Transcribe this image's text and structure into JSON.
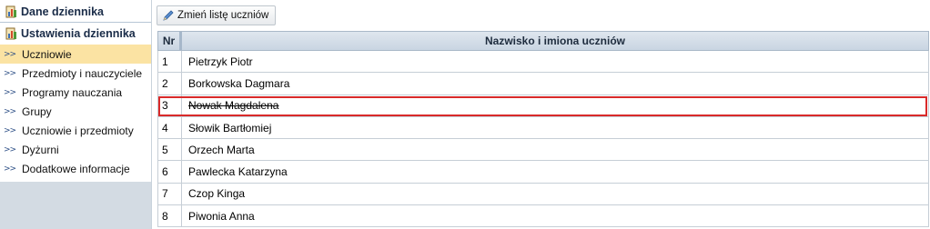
{
  "sidebar": {
    "section1": {
      "title": "Dane dziennika",
      "icon": "journal-chart-icon"
    },
    "section2": {
      "title": "Ustawienia dziennika",
      "icon": "journal-chart-icon"
    },
    "items": [
      {
        "label": "Uczniowie",
        "active": true
      },
      {
        "label": "Przedmioty i nauczyciele",
        "active": false
      },
      {
        "label": "Programy nauczania",
        "active": false
      },
      {
        "label": "Grupy",
        "active": false
      },
      {
        "label": "Uczniowie i przedmioty",
        "active": false
      },
      {
        "label": "Dyżurni",
        "active": false
      },
      {
        "label": "Dodatkowe informacje",
        "active": false
      }
    ],
    "chevron": ">>"
  },
  "toolbar": {
    "change_list_label": "Zmień listę uczniów",
    "icon": "edit-pencil-icon"
  },
  "table": {
    "columns": {
      "nr": "Nr",
      "name": "Nazwisko i imiona uczniów"
    },
    "rows": [
      {
        "nr": "1",
        "name": "Pietrzyk Piotr",
        "removed": false,
        "selected": false
      },
      {
        "nr": "2",
        "name": "Borkowska Dagmara",
        "removed": false,
        "selected": false
      },
      {
        "nr": "3",
        "name": "Nowak Magdalena",
        "removed": true,
        "selected": true
      },
      {
        "nr": "4",
        "name": "Słowik Bartłomiej",
        "removed": false,
        "selected": false
      },
      {
        "nr": "5",
        "name": "Orzech Marta",
        "removed": false,
        "selected": false
      },
      {
        "nr": "6",
        "name": "Pawlecka Katarzyna",
        "removed": false,
        "selected": false
      },
      {
        "nr": "7",
        "name": "Czop Kinga",
        "removed": false,
        "selected": false
      },
      {
        "nr": "8",
        "name": "Piwonia Anna",
        "removed": false,
        "selected": false
      }
    ]
  },
  "colors": {
    "active_item_bg": "#fbe3a3",
    "selection_border": "#d92a2a",
    "sidebar_bottom_bg": "#d3dbe3",
    "header_bg": "#c9d5e2"
  }
}
